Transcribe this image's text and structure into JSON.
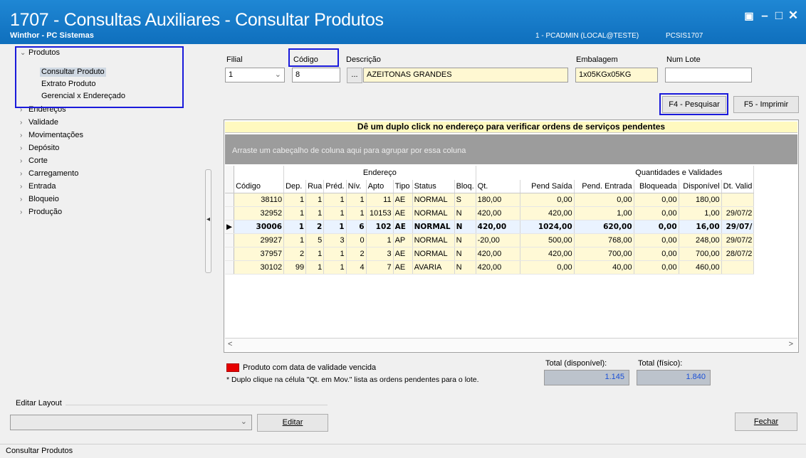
{
  "window": {
    "title": "1707 - Consultas Auxiliares - Consultar Produtos",
    "subtitle": "Winthor - PC Sistemas",
    "user_info": "1 - PCADMIN (LOCAL@TESTE)",
    "program": "PCSIS1707",
    "controls": {
      "restore": "▣",
      "minimize": "–",
      "maximize": "□",
      "close": "✕"
    }
  },
  "tree": {
    "produtos": "Produtos",
    "consultar_produto": "Consultar Produto",
    "extrato_produto": "Extrato Produto",
    "gerencial": "Gerencial x Endereçado",
    "enderecos": "Endereços",
    "validade": "Validade",
    "movimentacoes": "Movimentações",
    "deposito": "Depósito",
    "corte": "Corte",
    "carregamento": "Carregamento",
    "entrada": "Entrada",
    "bloqueio": "Bloqueio",
    "producao": "Produção",
    "expanded_arrow": "⌄",
    "collapsed_arrow": "›"
  },
  "filters": {
    "filial_label": "Filial",
    "filial_value": "1",
    "codigo_label": "Código",
    "codigo_value": "8",
    "descricao_label": "Descrição",
    "descricao_button": "...",
    "descricao_value": "AZEITONAS GRANDES",
    "embalagem_label": "Embalagem",
    "embalagem_value": "1x05KGx05KG",
    "numlote_label": "Num Lote",
    "numlote_value": "",
    "chevron": "⌄"
  },
  "buttons": {
    "pesquisar": "F4 - Pesquisar",
    "imprimir": "F5 - Imprimir",
    "editar": "Editar",
    "fechar": "Fechar"
  },
  "grid": {
    "banner": "Dê um duplo click no endereço para verificar ordens de serviços pendentes",
    "group_hint": "Arraste um cabeçalho de coluna aqui para agrupar por essa coluna",
    "band_endereco": "Endereço",
    "band_qtd": "Quantidades e Validades",
    "columns": [
      "Código",
      "Dep.",
      "Rua",
      "Préd.",
      "Nív.",
      "Apto",
      "Tipo",
      "Status",
      "Bloq.",
      "Qt.",
      "Pend Saída",
      "Pend. Entrada",
      "Bloqueada",
      "Disponível",
      "Dt. Valid"
    ],
    "rows": [
      [
        "38110",
        "1",
        "1",
        "1",
        "1",
        "11",
        "AE",
        "NORMAL",
        "S",
        "180,00",
        "0,00",
        "0,00",
        "0,00",
        "180,00",
        ""
      ],
      [
        "32952",
        "1",
        "1",
        "1",
        "1",
        "10153",
        "AE",
        "NORMAL",
        "N",
        "420,00",
        "420,00",
        "1,00",
        "0,00",
        "1,00",
        "29/07/2"
      ],
      [
        "30006",
        "1",
        "2",
        "1",
        "6",
        "102",
        "AE",
        "NORMAL",
        "N",
        "420,00",
        "1024,00",
        "620,00",
        "0,00",
        "16,00",
        "29/07/"
      ],
      [
        "29927",
        "1",
        "5",
        "3",
        "0",
        "1",
        "AP",
        "NORMAL",
        "N",
        "-20,00",
        "500,00",
        "768,00",
        "0,00",
        "248,00",
        "29/07/2"
      ],
      [
        "37957",
        "2",
        "1",
        "1",
        "2",
        "3",
        "AE",
        "NORMAL",
        "N",
        "420,00",
        "420,00",
        "700,00",
        "0,00",
        "700,00",
        "28/07/2"
      ],
      [
        "30102",
        "99",
        "1",
        "1",
        "4",
        "7",
        "AE",
        "AVARIA",
        "N",
        "420,00",
        "0,00",
        "40,00",
        "0,00",
        "460,00",
        ""
      ]
    ],
    "selected_row_indicator": "▶",
    "scroll_left": "<",
    "scroll_right": ">"
  },
  "legend": {
    "expired": "Produto com data de validade vencida",
    "hint": "* Duplo clique na célula \"Qt. em Mov.\" lista as ordens pendentes para o lote.",
    "expired_color": "#e60000"
  },
  "totals": {
    "disponivel_label": "Total (disponível):",
    "disponivel_value": "1.145",
    "fisico_label": "Total (físico):",
    "fisico_value": "1.840"
  },
  "layout_editor": {
    "label": "Editar Layout",
    "value": ""
  },
  "status_bar": {
    "text": "Consultar Produtos"
  },
  "colors": {
    "titlebar": "#1474c4",
    "highlight": "#1a1adb",
    "row_bg": "#fff9d6",
    "banner": "#fff9bf"
  }
}
